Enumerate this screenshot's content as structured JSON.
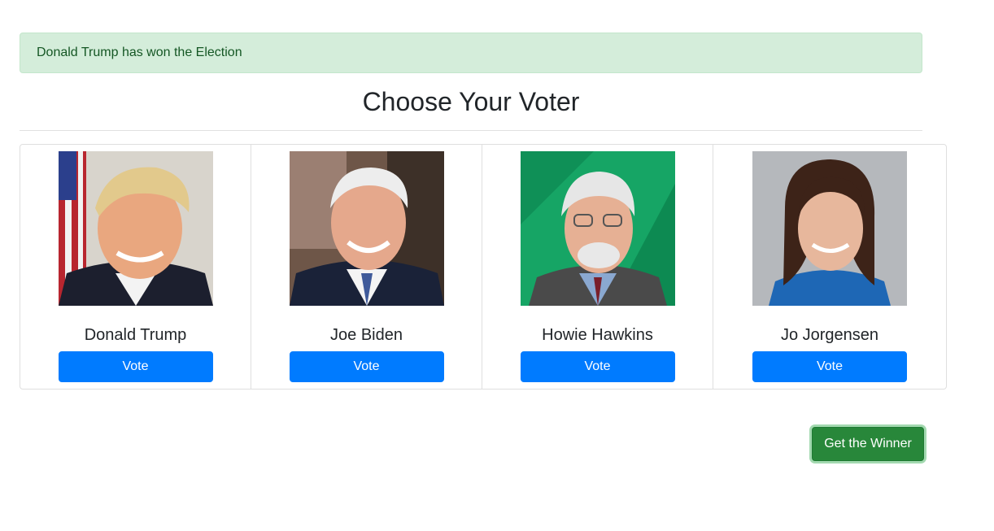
{
  "alert": {
    "text": "Donald Trump has won the Election"
  },
  "page": {
    "title": "Choose Your Voter"
  },
  "candidates": [
    {
      "name": "Donald Trump",
      "vote_label": "Vote",
      "photo": "donald-trump-portrait"
    },
    {
      "name": "Joe Biden",
      "vote_label": "Vote",
      "photo": "joe-biden-portrait"
    },
    {
      "name": "Howie Hawkins",
      "vote_label": "Vote",
      "photo": "howie-hawkins-portrait"
    },
    {
      "name": "Jo Jorgensen",
      "vote_label": "Vote",
      "photo": "jo-jorgensen-portrait"
    }
  ],
  "actions": {
    "winner_label": "Get the Winner"
  },
  "colors": {
    "alert_bg": "#d4edda",
    "alert_text": "#155724",
    "vote_button": "#007bff",
    "winner_button": "#28873a"
  }
}
